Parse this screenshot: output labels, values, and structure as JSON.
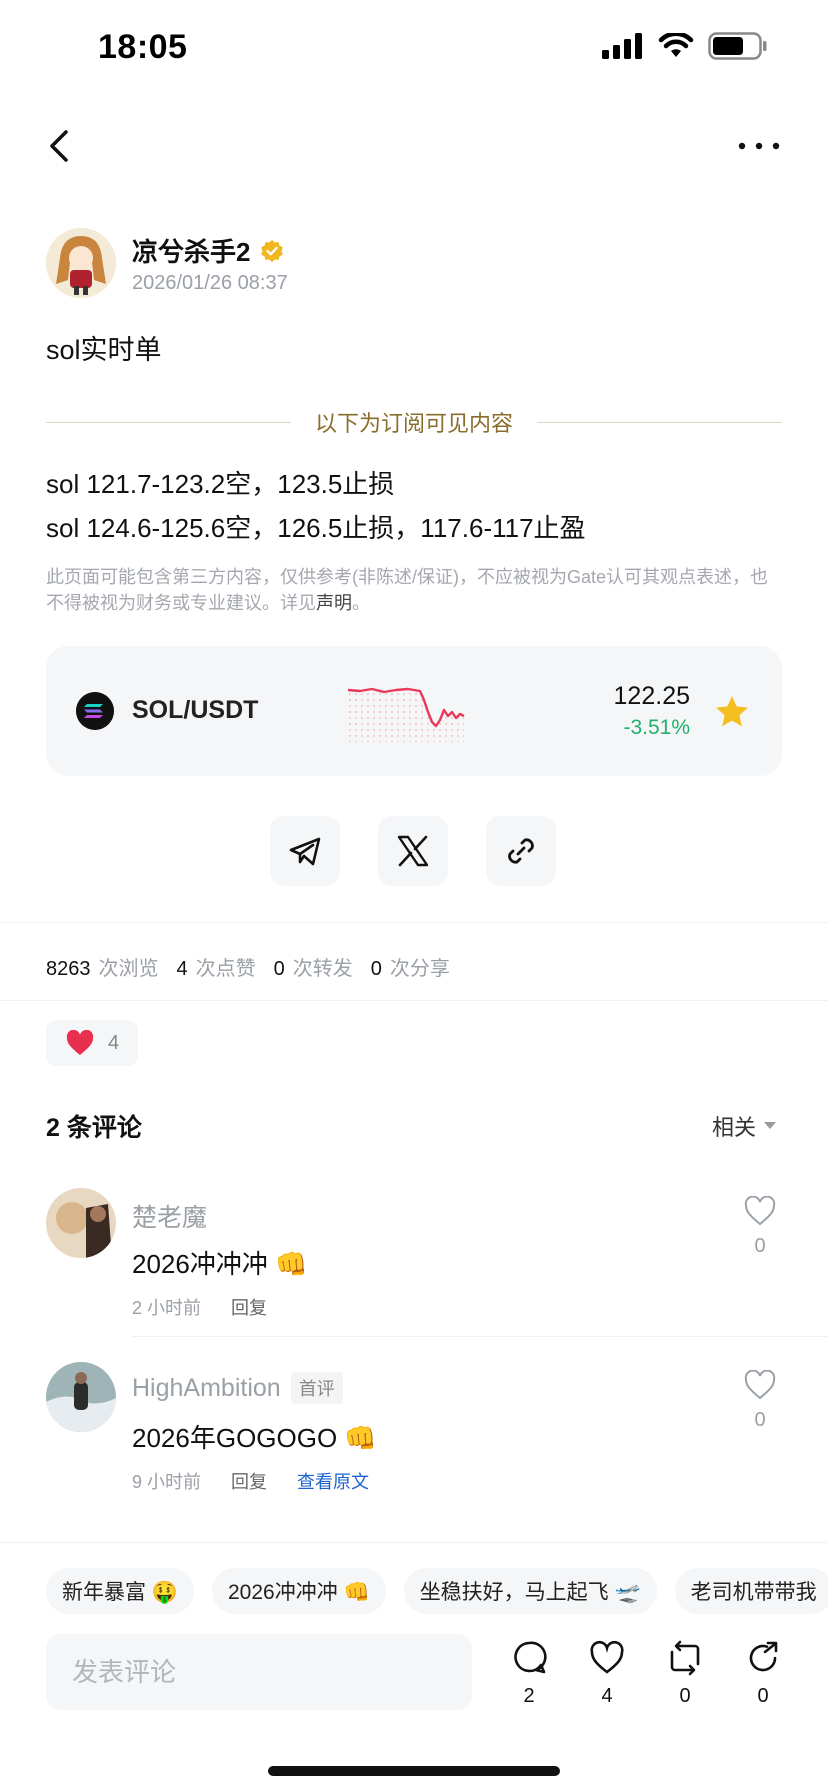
{
  "status_bar": {
    "time": "18:05"
  },
  "post": {
    "author": "凉兮杀手2",
    "date": "2026/01/26 08:37",
    "text": "sol实时单",
    "subscriber_divider": "以下为订阅可见内容",
    "lines": [
      "sol 121.7-123.2空，123.5止损",
      "sol 124.6-125.6空，126.5止损，117.6-117止盈"
    ],
    "disclaimer_text": "此页面可能包含第三方内容，仅供参考(非陈述/保证)，不应被视为Gate认可其观点表述，也不得被视为财务或专业建议。详见",
    "disclaimer_link": "声明",
    "disclaimer_end": "。"
  },
  "ticker": {
    "pair": "SOL/USDT",
    "price": "122.25",
    "change": "-3.51%",
    "change_color": "#20b26c",
    "sparkline_color": "#e8395a",
    "favorited": true
  },
  "share": {
    "buttons": [
      "telegram-icon",
      "x-icon",
      "link-icon"
    ]
  },
  "stats": [
    {
      "value": "8263",
      "label": "次浏览"
    },
    {
      "value": "4",
      "label": "次点赞"
    },
    {
      "value": "0",
      "label": "次转发"
    },
    {
      "value": "0",
      "label": "次分享"
    }
  ],
  "reaction": {
    "emoji": "heart-icon",
    "count": "4"
  },
  "comments_section": {
    "title": "2 条评论",
    "sort": "相关"
  },
  "comments": [
    {
      "name": "楚老魔",
      "badge": "",
      "text": "2026冲冲冲 👊",
      "time": "2 小时前",
      "reply": "回复",
      "view_original": "",
      "likes": "0"
    },
    {
      "name": "HighAmbition",
      "badge": "首评",
      "text": "2026年GOGOGO 👊",
      "time": "9 小时前",
      "reply": "回复",
      "view_original": "查看原文",
      "likes": "0"
    }
  ],
  "quick_replies": [
    "新年暴富 🤑",
    "2026冲冲冲 👊",
    "坐稳扶好，马上起飞 🛫",
    "老司机带带我"
  ],
  "bottom_bar": {
    "comment_placeholder": "发表评论",
    "actions": [
      {
        "icon": "comment-icon",
        "count": "2"
      },
      {
        "icon": "like-icon",
        "count": "4"
      },
      {
        "icon": "repost-icon",
        "count": "0"
      },
      {
        "icon": "share-icon",
        "count": "0"
      }
    ]
  }
}
